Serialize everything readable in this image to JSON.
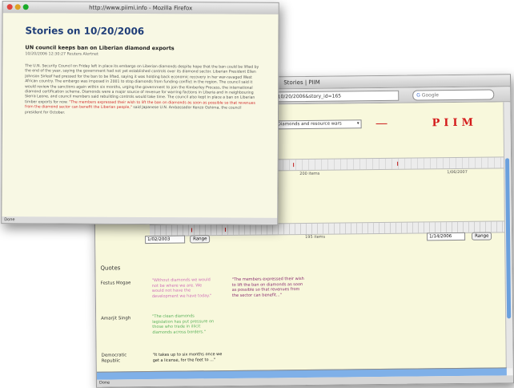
{
  "front_window": {
    "title": "http://www.piimi.info - Mozilla Firefox",
    "page_title": "Stories on 10/20/2006",
    "story_headline": "UN council keeps ban on Liberian diamond exports",
    "story_meta": "10/20/2006 12:30:27  Reuters Alertnet",
    "story_body": "The U.N. Security Council on Friday left in place its embargo on Liberian diamonds despite hope that the ban could be lifted by the end of the year, saying the government had not yet established controls over its diamond sector. Liberian President Ellen Johnson Sirleaf had pressed for the ban to be lifted, saying it was holding back economic recovery in her war-ravaged West African country. The embargo was imposed in 2001 to stop diamonds from funding conflict in the region. The council said it would review the sanctions again within six months, urging the government to join the Kimberley Process, the international diamond certification scheme. Diamonds were a major source of revenue for warring factions in Liberia and in neighbouring Sierra Leone, and council members said rebuilding controls would take time. The council also kept in place a ban on Liberian timber exports for now.",
    "story_highlight": "\"The members expressed their wish to lift the ban on diamonds as soon as possible so that revenues from the diamond sector can benefit the Liberian people,\"",
    "story_tail": "said Japanese U.N. Ambassador Kenzo Oshima, the council president for October.",
    "status": "Done"
  },
  "back_window": {
    "title": "Stories | PIIM",
    "url": "http://www.piimi.info/stories.php?date=10/20/2006&story_id=165",
    "search_placeholder": "Google",
    "select_value": "Diamonds and resource wars",
    "logo_text": "PIIM",
    "timeline_top": {
      "mid_label": "200 items",
      "right_label": "1/06/2007"
    },
    "timeline_bottom": {
      "mid_label": "195 items"
    },
    "range_start": "1/02/2003",
    "range_end": "1/14/2006",
    "range_button": "Range",
    "quotes_heading": "Quotes",
    "quotes": [
      {
        "speaker": "Festus Mogae",
        "left": "\"Without diamonds we would not be where we are. We would not have the development we have today.\"",
        "right": "\"The members expressed their wish to lift the ban on diamonds as soon as possible so that revenues from the sector can benefit...\""
      },
      {
        "speaker": "Amarjit Singh",
        "left": "\"The clean diamonds legislation has put pressure on those who trade in illicit diamonds across borders.\"",
        "right": ""
      },
      {
        "speaker": "Democratic Republic",
        "left": "\"It takes up to six months once we get a license, for the feet to ...\"",
        "right": ""
      }
    ],
    "status": "Done"
  },
  "colors": {
    "page_background": "#f8f8dc",
    "title_blue": "#1e3d78",
    "logo_red": "#d41b1b",
    "scroll_blue": "#7fb0e8"
  }
}
